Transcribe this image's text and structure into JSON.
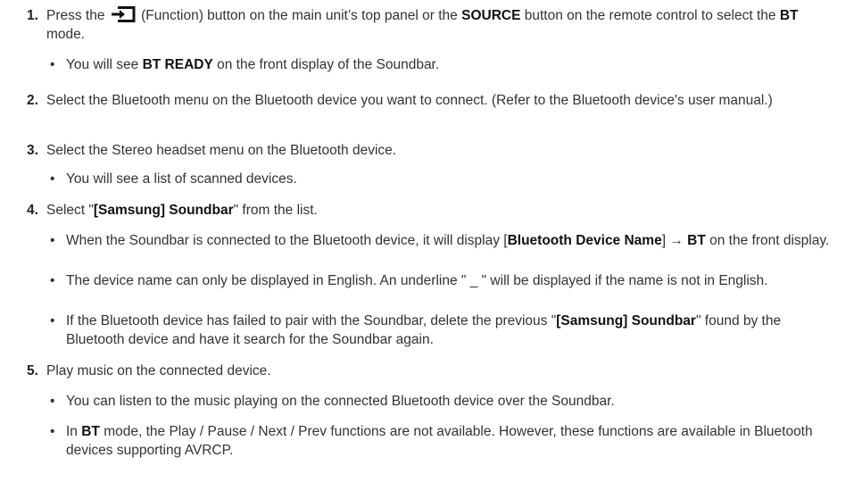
{
  "steps": [
    {
      "num": "1.",
      "pre1": "Press the ",
      "icon_name": "function-source-icon",
      "pre2": " (Function) button on the main unit’s top panel or the ",
      "bold1": "SOURCE",
      "mid1": " button on the remote control to select the ",
      "bold2": "BT",
      "post": " mode.",
      "bullets": [
        {
          "pre": "You will see ",
          "bold": "BT READY",
          "post": " on the front display of the Soundbar."
        }
      ]
    },
    {
      "num": "2.",
      "text": "Select the Bluetooth menu on the Bluetooth device you want to connect. (Refer to the Bluetooth device's user manual.)"
    },
    {
      "num": "3.",
      "text": "Select the Stereo headset menu on the Bluetooth device.",
      "bullets": [
        {
          "text": "You will see a list of scanned devices."
        }
      ]
    },
    {
      "num": "4.",
      "pre": "Select \"",
      "bold": "[Samsung] Soundbar",
      "post": "\" from the list.",
      "bullets": [
        {
          "pre": "When the Soundbar is connected to the Bluetooth device, it will display [",
          "bold1": "Bluetooth Device Name",
          "mid": "] → ",
          "bold2": "BT",
          "post": " on the front display."
        },
        {
          "text": "The device name can only be displayed in English. An underline \" _ \" will be displayed if the name is not in English."
        },
        {
          "pre": "If the Bluetooth device has failed to pair with the Soundbar, delete the previous \"",
          "bold": "[Samsung] Soundbar",
          "post": "\" found by the Bluetooth device and have it search for the Soundbar again."
        }
      ]
    },
    {
      "num": "5.",
      "text": "Play music on the connected device.",
      "bullets": [
        {
          "text": "You can listen to the music playing on the connected Bluetooth device over the Soundbar."
        },
        {
          "pre": "In ",
          "bold": "BT",
          "post": " mode, the Play / Pause / Next / Prev functions are not available. However, these functions are available in Bluetooth devices supporting AVRCP."
        }
      ]
    }
  ],
  "bullet_glyph": "•"
}
